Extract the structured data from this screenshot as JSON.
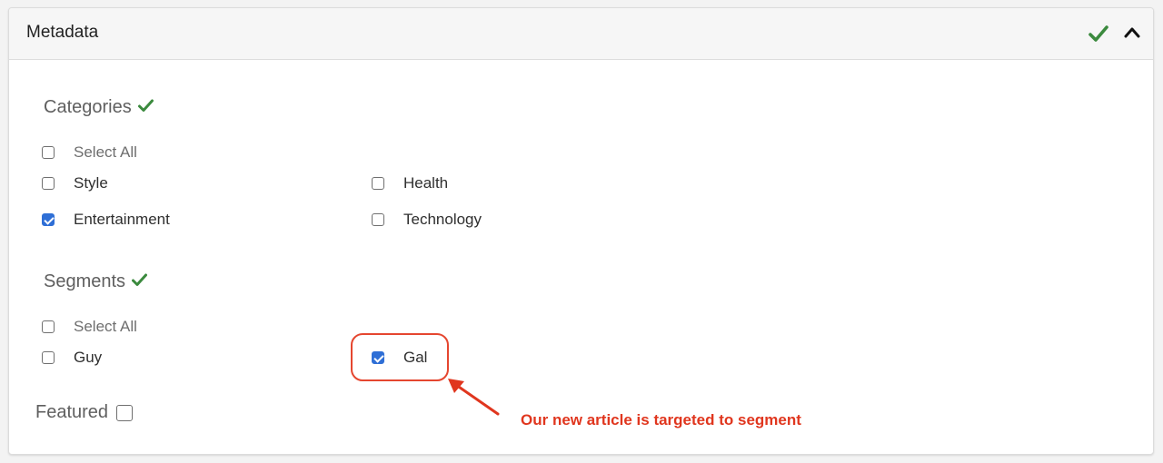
{
  "panel": {
    "title": "Metadata",
    "status_icon": "check-icon",
    "toggle_icon": "chevron-up-icon",
    "accent_color": "#3b8a3e"
  },
  "categories": {
    "title": "Categories",
    "select_all": {
      "label": "Select All",
      "checked": false
    },
    "options": [
      {
        "label": "Style",
        "checked": false
      },
      {
        "label": "Health",
        "checked": false
      },
      {
        "label": "Entertainment",
        "checked": true
      },
      {
        "label": "Technology",
        "checked": false
      }
    ]
  },
  "segments": {
    "title": "Segments",
    "select_all": {
      "label": "Select All",
      "checked": false
    },
    "options": [
      {
        "label": "Guy",
        "checked": false
      },
      {
        "label": "Gal",
        "checked": true
      }
    ]
  },
  "featured": {
    "label": "Featured",
    "checked": false
  },
  "annotation": {
    "text": "Our new article is targeted to segment",
    "color": "#e0361e"
  }
}
